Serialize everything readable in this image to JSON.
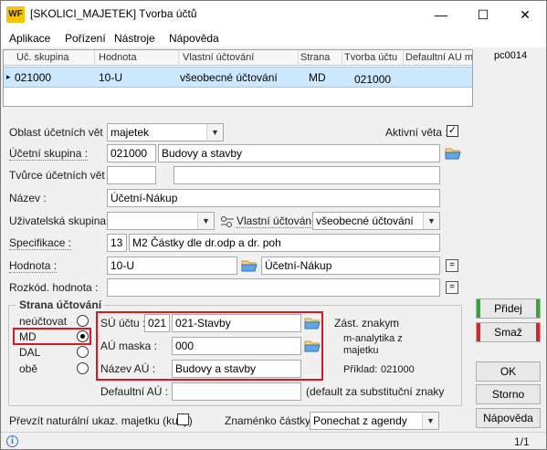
{
  "window": {
    "logo": "WF",
    "title": "[SKOLICI_MAJETEK] Tvorba účtů",
    "controls": {
      "minimize": "—",
      "maximize": "☐",
      "close": "✕"
    }
  },
  "menu": [
    "Aplikace",
    "Pořízení",
    "Nástroje",
    "Nápověda"
  ],
  "grid": {
    "columns": [
      "Úč. skupina",
      "Hodnota",
      "Vlastní účtování",
      "Strana",
      "Tvorba účtu",
      "Defaultní AU m"
    ],
    "rows": [
      {
        "marker": "▸",
        "skupina": "021000",
        "hodnota": "10-U",
        "vlastni": "všeobecné účtování",
        "strana": "MD",
        "tvorba": "021000",
        "default": ""
      }
    ]
  },
  "pc_code": "pc0014",
  "form": {
    "oblast": {
      "label": "Oblast účetních vět :",
      "value": "majetek"
    },
    "aktivni": {
      "label": "Aktivní věta :",
      "checked": "✓"
    },
    "ucetni_skupina": {
      "label": "Účetní skupina :",
      "code": "021000",
      "name": "Budovy a stavby"
    },
    "tvurce": {
      "label": "Tvůrce účetních vět :",
      "code": "",
      "name": ""
    },
    "nazev": {
      "label": "Název :",
      "value": "Účetní-Nákup"
    },
    "uziv_skupina": {
      "label": "Uživatelská skupina :",
      "value": ""
    },
    "vlastni_uctovani": {
      "label": "Vlastní účtování :",
      "value": "všeobecné účtování"
    },
    "specifikace": {
      "label": "Specifikace :",
      "code": "13",
      "name": "M2 Částky dle dr.odp a dr. poh"
    },
    "hodnota": {
      "label": "Hodnota :",
      "code": "10-U",
      "name": "Účetní-Nákup",
      "btn": "="
    },
    "rozkod": {
      "label": "Rozkód. hodnota :",
      "value": "",
      "btn": "="
    }
  },
  "strana": {
    "title": "Strana účtování",
    "options": [
      "neúčtovat",
      "MD",
      "DAL",
      "obě"
    ],
    "selected": "MD"
  },
  "ucet": {
    "su_label": "SÚ účtu :",
    "su_code": "021",
    "su_name": "021-Stavby",
    "au_label": "AÚ maska :",
    "au_value": "000",
    "nazev_label": "Název AÚ :",
    "nazev_value": "Budovy a stavby"
  },
  "zast": {
    "label": "Zást. znaky :",
    "value": "m",
    "desc_line1": "m-analytika z",
    "desc_line2": "majetku",
    "priklad_label": "Příklad:",
    "priklad_value": "021000"
  },
  "defaultni_au": {
    "label": "Defaultní AÚ :",
    "value": "",
    "note": "(default za substituční znaky"
  },
  "prevzit": {
    "label": "Převzít naturální ukaz. majetku (kusy)",
    "checked": ""
  },
  "znamenko": {
    "label": "Znaménko částky :",
    "value": "Ponechat z agendy"
  },
  "buttons": {
    "pridej": "Přidej",
    "smaz": "Smaž",
    "ok": "OK",
    "storno": "Storno",
    "napoveda": "Nápověda"
  },
  "status": {
    "page": "1/1",
    "info": "i"
  },
  "colors": {
    "accent_red": "#e0161e",
    "selected_row": "#cce8ff",
    "add_stripe": "#3aa33a",
    "delete_stripe": "#d62828"
  }
}
